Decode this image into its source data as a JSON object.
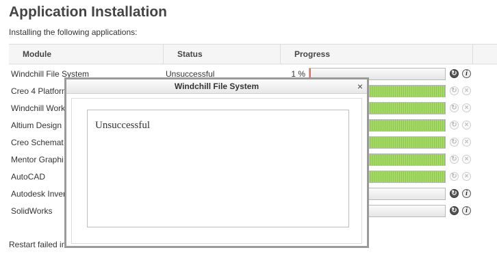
{
  "page": {
    "title": "Application Installation",
    "subtitle": "Installing the following applications:",
    "footer": "Restart failed in"
  },
  "table": {
    "headers": {
      "module": "Module",
      "status": "Status",
      "progress": "Progress"
    },
    "rows": [
      {
        "module": "Windchill File System",
        "status": "Unsuccessful",
        "percent_label": "1 %",
        "progress": 0.01,
        "state": "failed"
      },
      {
        "module": "Creo 4 Platform",
        "status": "",
        "percent_label": "",
        "progress": 1.0,
        "state": "complete"
      },
      {
        "module": "Windchill Work",
        "status": "",
        "percent_label": "",
        "progress": 1.0,
        "state": "complete"
      },
      {
        "module": "Altium Design",
        "status": "",
        "percent_label": "",
        "progress": 1.0,
        "state": "complete"
      },
      {
        "module": "Creo Schemat",
        "status": "",
        "percent_label": "",
        "progress": 1.0,
        "state": "complete"
      },
      {
        "module": "Mentor Graphi",
        "status": "",
        "percent_label": "",
        "progress": 1.0,
        "state": "complete"
      },
      {
        "module": "AutoCAD",
        "status": "",
        "percent_label": "",
        "progress": 1.0,
        "state": "complete"
      },
      {
        "module": "Autodesk Inver",
        "status": "",
        "percent_label": "",
        "progress": 0.0,
        "state": "failed"
      },
      {
        "module": "SolidWorks",
        "status": "",
        "percent_label": "",
        "progress": 0.0,
        "state": "failed"
      }
    ]
  },
  "icons": {
    "retry": "refresh-icon",
    "info_glyph": "i",
    "cancel_glyph": "×",
    "retry_glyph": "↻"
  },
  "dialog": {
    "title": "Windchill File System",
    "close_glyph": "×",
    "message": "Unsuccessful"
  },
  "colors": {
    "progress_fill": "#a6d96a",
    "failed_fill": "#e07060"
  }
}
